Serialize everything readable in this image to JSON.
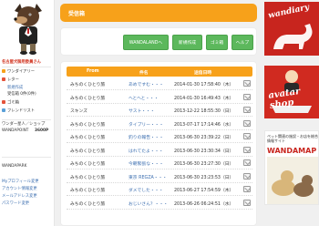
{
  "sidebar": {
    "user_name": "名古屋犬御用委員さん",
    "items": [
      {
        "label": "ワンダイアリー",
        "color": "#f7a11a"
      },
      {
        "label": "レター",
        "color": "#e4533a"
      },
      {
        "label": "新規作成",
        "color": ""
      },
      {
        "label": "受信箱 0件(0件)",
        "color": ""
      },
      {
        "label": "ゴミ箱",
        "color": "#e4533a"
      },
      {
        "label": "フレンドリスト",
        "color": "#5aa0d8"
      }
    ],
    "shop_link": "ワンダー星人／ショップ",
    "points_label": "WANDAPOINT",
    "points_value": "3600P",
    "section2_title": "WANDAPARK",
    "links": [
      "Myプロフィール変更",
      "アカウント情報変更",
      "メールアドレス変更",
      "パスワード変更"
    ]
  },
  "main": {
    "title": "受信箱",
    "buttons": [
      "WANDALANDへ",
      "新規作成",
      "ゴミ箱",
      "ヘルプ"
    ],
    "columns": [
      "From",
      "件名",
      "送信日時"
    ],
    "rows": [
      {
        "from": "みちのくひとり旅",
        "subject": "あめですむ・・・",
        "date": "2014-01-30 17:58:40（木）"
      },
      {
        "from": "みちのくひとり旅",
        "subject": "へとへと・・・",
        "date": "2014-01-30 16:49:43（木）"
      },
      {
        "from": "スキンズ",
        "subject": "サスト・・・",
        "date": "2013-12-22 18:55:30（日）"
      },
      {
        "from": "みちのくひとり旅",
        "subject": "タイプリー・・・",
        "date": "2013-07-17 17:14:46（水）"
      },
      {
        "from": "みちのくひとり旅",
        "subject": "釣りの報告・・・",
        "date": "2013-06-30 23:39:22（日）"
      },
      {
        "from": "みちのくひとり旅",
        "subject": "はれてたよ・・・",
        "date": "2013-06-30 23:30:34（日）"
      },
      {
        "from": "みちのくひとり旅",
        "subject": "今朝緊張な・・・",
        "date": "2013-06-30 23:27:30（日）"
      },
      {
        "from": "みちのくひとり旅",
        "subject": "東京 REGZA・・・",
        "date": "2013-06-30 23:23:53（日）"
      },
      {
        "from": "みちのくひとり旅",
        "subject": "ダメでした・・・",
        "date": "2013-06-27 17:54:59（木）"
      },
      {
        "from": "みちのくひとり旅",
        "subject": "おじいさん？・・・",
        "date": "2013-06-26 06:24:51（水）"
      }
    ]
  },
  "banners": {
    "wandiary": "wandiary",
    "avatar_shop": "avatar shop",
    "wanda_caption": "ペット関連の施設・お店を総合情報サイト",
    "wanda_logo": "WANDAMAP"
  },
  "colors": {
    "accent": "#f7a11a",
    "button_green": "#5cb85c",
    "banner_red": "#c8251e",
    "link_blue": "#3d6fb0"
  }
}
